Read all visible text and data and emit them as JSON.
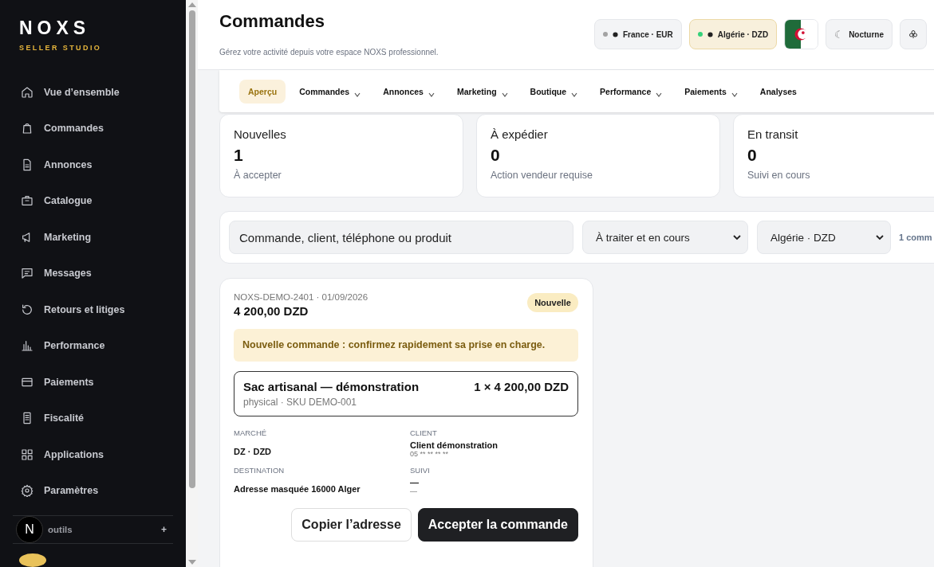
{
  "brand": {
    "name": "NOXS",
    "tagline": "SELLER STUDIO"
  },
  "sidebar": {
    "items": [
      {
        "label": "Vue d’ensemble",
        "selected": false
      },
      {
        "label": "Commandes",
        "selected": false
      },
      {
        "label": "Annonces",
        "selected": false
      },
      {
        "label": "Catalogue",
        "selected": false
      },
      {
        "label": "Marketing",
        "selected": false
      },
      {
        "label": "Messages",
        "selected": false
      },
      {
        "label": "Retours et litiges",
        "selected": false
      },
      {
        "label": "Performance",
        "selected": false
      },
      {
        "label": "Paiements",
        "selected": false
      },
      {
        "label": "Fiscalité",
        "selected": false
      },
      {
        "label": "Applications",
        "selected": false
      },
      {
        "label": "Paramètres",
        "selected": false
      }
    ],
    "tools": {
      "badge": "N",
      "label": "outils",
      "action": "+"
    }
  },
  "header": {
    "title": "Commandes",
    "subtitle": "Gérez votre activité depuis votre espace NOXS professionnel.",
    "markets": [
      {
        "label": "France · EUR",
        "selected": false
      },
      {
        "label": "Algérie · DZD",
        "selected": true
      }
    ],
    "theme_button": {
      "icon": "☾",
      "label": "Nocturne"
    }
  },
  "tabs": [
    {
      "label": "Aperçu",
      "selected": true,
      "has_menu": false
    },
    {
      "label": "Commandes",
      "selected": false,
      "has_menu": true
    },
    {
      "label": "Annonces",
      "selected": false,
      "has_menu": true
    },
    {
      "label": "Marketing",
      "selected": false,
      "has_menu": true
    },
    {
      "label": "Boutique",
      "selected": false,
      "has_menu": true
    },
    {
      "label": "Performance",
      "selected": false,
      "has_menu": true
    },
    {
      "label": "Paiements",
      "selected": false,
      "has_menu": true
    },
    {
      "label": "Analyses",
      "selected": false,
      "has_menu": false
    }
  ],
  "stats": [
    {
      "title": "Nouvelles",
      "value": "1",
      "caption": "À accepter"
    },
    {
      "title": "À expédier",
      "value": "0",
      "caption": "Action vendeur requise"
    },
    {
      "title": "En transit",
      "value": "0",
      "caption": "Suivi en cours"
    }
  ],
  "filters": {
    "search": {
      "placeholder": "Commande, client, téléphone ou produit"
    },
    "status_select": "À traiter et en cours",
    "market_select": "Algérie · DZD",
    "count": "1 comm"
  },
  "order": {
    "ref": "NOXS-DEMO-2401 · 01/09/2026",
    "total": "4 200,00 DZD",
    "status": "Nouvelle",
    "alert": "Nouvelle commande : confirmez rapidement sa prise en charge.",
    "item": {
      "name": "Sac artisanal — démonstration",
      "meta": "physical · SKU DEMO-001",
      "price": "1 × 4 200,00 DZD"
    },
    "details": [
      {
        "label": "MARCHÉ",
        "value": "DZ · DZD"
      },
      {
        "label": "CLIENT",
        "value": "Client démonstration",
        "sub": "05 ** ** ** **"
      },
      {
        "label": "DESTINATION",
        "value": "Adresse masquée 16000 Alger"
      },
      {
        "label": "SUIVI",
        "value": "—",
        "sub": "—"
      }
    ],
    "buttons": [
      {
        "label": "Copier l’adresse",
        "kind": "secondary"
      },
      {
        "label": "Accepter la commande",
        "kind": "primary"
      }
    ]
  }
}
